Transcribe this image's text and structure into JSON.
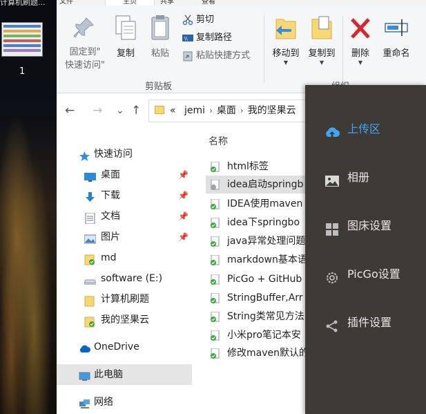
{
  "desktop": {
    "tab_title": "计算机刷题...",
    "count": "1"
  },
  "ribbon": {
    "tabs": [
      "文件",
      "主页",
      "共享",
      "查看"
    ],
    "buttons": {
      "pin": "固定到\"\n快速访问\"",
      "pin_line1": "固定到\"",
      "pin_line2": "快速访问\"",
      "copy": "复制",
      "paste": "粘贴",
      "cut": "剪切",
      "copy_path": "复制路径",
      "paste_shortcut": "粘贴快捷方式",
      "move_to": "移动到",
      "copy_to": "复制到",
      "delete": "删除",
      "rename": "重命名"
    },
    "groups": {
      "clipboard": "剪贴板",
      "organize": "组织"
    }
  },
  "nav": {
    "back": "←",
    "forward": "→",
    "recent": "⌄",
    "up": "↑",
    "breadcrumb": [
      "«",
      "jemi",
      "桌面",
      "我的坚果云"
    ],
    "crumb_sep": "›"
  },
  "navpane": {
    "items": [
      {
        "label": "快速访问",
        "icon": "star-icon"
      },
      {
        "label": "桌面",
        "icon": "desktop-icon",
        "pinned": true
      },
      {
        "label": "下载",
        "icon": "download-icon",
        "pinned": true
      },
      {
        "label": "文档",
        "icon": "document-icon",
        "pinned": true
      },
      {
        "label": "图片",
        "icon": "picture-icon",
        "pinned": true
      },
      {
        "label": "md",
        "icon": "synced-folder-icon"
      },
      {
        "label": "software (E:)",
        "icon": "drive-icon"
      },
      {
        "label": "计算机刷题",
        "icon": "folder-icon"
      },
      {
        "label": "我的坚果云",
        "icon": "synced-folder-icon"
      },
      {
        "label": "OneDrive",
        "icon": "cloud-icon"
      },
      {
        "label": "此电脑",
        "icon": "computer-icon"
      },
      {
        "label": "网络",
        "icon": "network-icon"
      }
    ],
    "pin_glyph": "📌"
  },
  "filelist": {
    "column_name": "名称",
    "files": [
      "html标签",
      "idea启动springb",
      "IDEA使用maven",
      "idea下springbo",
      "java异常处理问题",
      "markdown基本语",
      "PicGo + GitHub",
      "StringBuffer,Arr",
      "String类常见方法",
      "小米pro笔记本安",
      "修改maven默认的"
    ]
  },
  "picgo": {
    "menu": [
      {
        "label": "上传区",
        "icon": "upload-cloud-icon",
        "active": true
      },
      {
        "label": "相册",
        "icon": "picture-icon",
        "active": false
      },
      {
        "label": "图床设置",
        "icon": "grid-icon",
        "active": false
      },
      {
        "label": "PicGo设置",
        "icon": "gear-icon",
        "active": false
      },
      {
        "label": "插件设置",
        "icon": "share-icon",
        "active": false
      }
    ],
    "accent": "#3fa6f2"
  }
}
